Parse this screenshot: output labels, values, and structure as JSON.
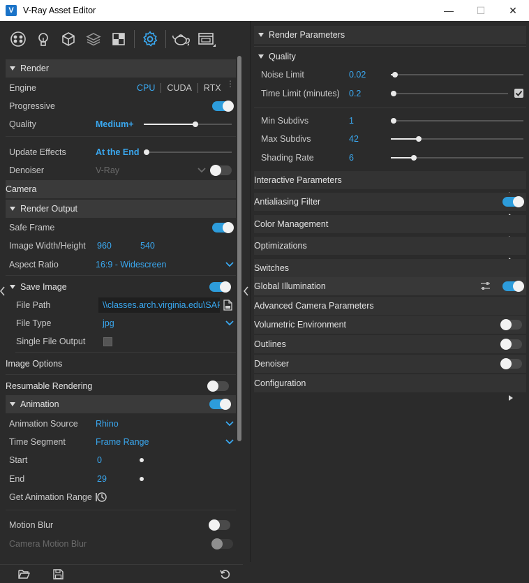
{
  "window": {
    "title": "V-Ray Asset Editor",
    "minimize": "—",
    "maximize": "☐",
    "close": "✕"
  },
  "colors": {
    "accent": "#3aa8f0",
    "toggle_on": "#2d9cdb"
  },
  "toolbar": {
    "icons": [
      "materials-icon",
      "lights-icon",
      "geometry-icon",
      "layers-icon",
      "textures-icon",
      "settings-icon",
      "render-teapot-icon",
      "frame-buffer-icon"
    ]
  },
  "left": {
    "render": {
      "label": "Render"
    },
    "engine": {
      "label": "Engine",
      "options": [
        "CPU",
        "CUDA",
        "RTX"
      ],
      "selected": "CPU"
    },
    "progressive": {
      "label": "Progressive",
      "on": true
    },
    "quality": {
      "label": "Quality",
      "value": "Medium+"
    },
    "update_effects": {
      "label": "Update Effects",
      "value": "At the End"
    },
    "denoiser": {
      "label": "Denoiser",
      "value": "V-Ray",
      "on": false
    },
    "camera": {
      "label": "Camera"
    },
    "render_output": {
      "label": "Render Output"
    },
    "safe_frame": {
      "label": "Safe Frame",
      "on": true
    },
    "image_wh": {
      "label": "Image Width/Height",
      "width": "960",
      "height": "540"
    },
    "aspect": {
      "label": "Aspect Ratio",
      "value": "16:9 - Widescreen"
    },
    "save_image": {
      "label": "Save Image",
      "on": true
    },
    "file_path": {
      "label": "File Path",
      "value": "\\\\classes.arch.virginia.edu\\SARC"
    },
    "file_type": {
      "label": "File Type",
      "value": "jpg"
    },
    "single_file": {
      "label": "Single File Output"
    },
    "image_options": {
      "label": "Image Options"
    },
    "resumable": {
      "label": "Resumable Rendering",
      "on": false
    },
    "animation": {
      "label": "Animation",
      "on": true
    },
    "anim_source": {
      "label": "Animation Source",
      "value": "Rhino"
    },
    "time_segment": {
      "label": "Time Segment",
      "value": "Frame Range"
    },
    "start": {
      "label": "Start",
      "value": "0"
    },
    "end": {
      "label": "End",
      "value": "29"
    },
    "get_range": {
      "label": "Get Animation Range"
    },
    "motion_blur": {
      "label": "Motion Blur",
      "on": false
    },
    "camera_motion_blur": {
      "label": "Camera Motion Blur"
    }
  },
  "right": {
    "render_params": {
      "label": "Render Parameters"
    },
    "quality": {
      "label": "Quality"
    },
    "noise_limit": {
      "label": "Noise Limit",
      "value": "0.02"
    },
    "time_limit": {
      "label": "Time Limit (minutes)",
      "value": "0.2"
    },
    "min_subdivs": {
      "label": "Min Subdivs",
      "value": "1"
    },
    "max_subdivs": {
      "label": "Max Subdivs",
      "value": "42"
    },
    "shading_rate": {
      "label": "Shading Rate",
      "value": "6"
    },
    "sections": [
      {
        "label": "Interactive Parameters"
      },
      {
        "label": "Antialiasing Filter"
      },
      {
        "label": "Color Management"
      },
      {
        "label": "Optimizations"
      },
      {
        "label": "Switches"
      },
      {
        "label": "Global Illumination"
      },
      {
        "label": "Advanced Camera Parameters"
      },
      {
        "label": "Volumetric Environment"
      },
      {
        "label": "Outlines"
      },
      {
        "label": "Denoiser"
      },
      {
        "label": "Configuration"
      }
    ]
  }
}
